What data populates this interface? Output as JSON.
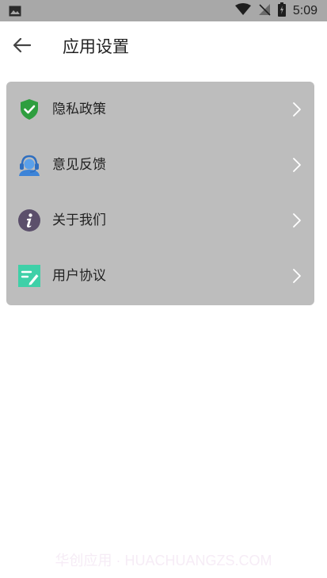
{
  "status_bar": {
    "time": "5:09",
    "icons": [
      "image-icon",
      "wifi-icon",
      "no-signal-icon",
      "battery-icon"
    ]
  },
  "app_bar": {
    "back_icon": "arrow-left-icon",
    "title": "应用设置"
  },
  "settings": {
    "items": [
      {
        "label": "隐私政策",
        "icon": "shield-check-icon"
      },
      {
        "label": "意见反馈",
        "icon": "customer-service-icon"
      },
      {
        "label": "关于我们",
        "icon": "info-icon"
      },
      {
        "label": "用户协议",
        "icon": "agreement-edit-icon"
      }
    ],
    "chevron_icon": "chevron-right-icon"
  },
  "watermark": "华创应用 · HUACHUANGZS.COM",
  "colors": {
    "status_bar": "#a8a8a8",
    "card_bg": "#bdbdbd",
    "shield": "#2e9e3f",
    "headset": "#3d84d8",
    "info": "#5b4f6b",
    "agreement": "#3fd0a8"
  }
}
